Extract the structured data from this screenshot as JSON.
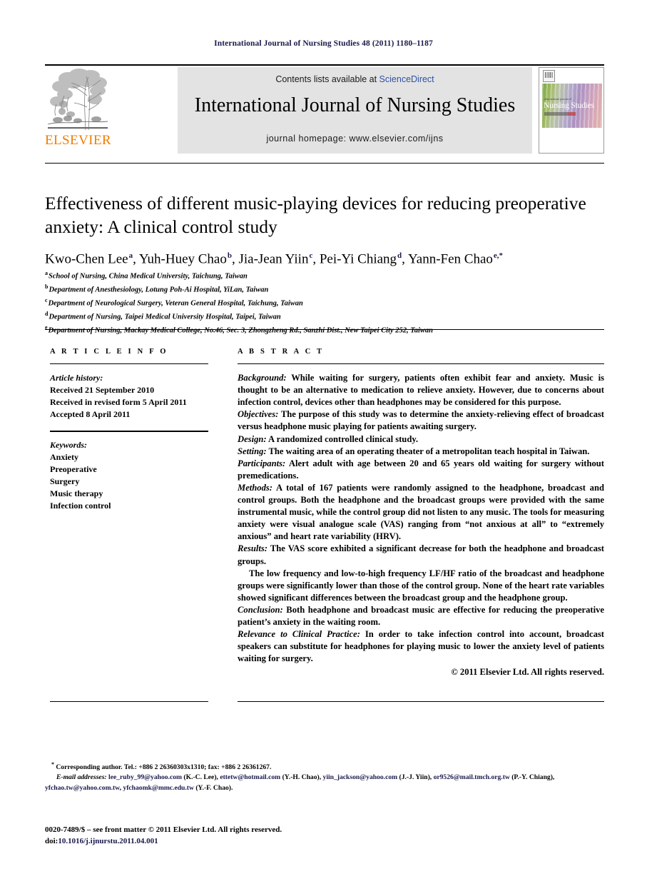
{
  "running_head": "International Journal of Nursing Studies 48 (2011) 1180–1187",
  "masthead": {
    "publisher_wordmark": "ELSEVIER",
    "contents_prefix": "Contents lists available at ",
    "contents_link": "ScienceDirect",
    "journal_title": "International Journal of Nursing Studies",
    "homepage": "journal homepage: www.elsevier.com/ijns",
    "cover": {
      "small_line": "international journal of",
      "title": "Nursing Studies",
      "editors_line": "Editor-in-Chief: Ian Norman"
    }
  },
  "article": {
    "title": "Effectiveness of different music-playing devices for reducing preoperative anxiety: A clinical control study",
    "authors": [
      {
        "name": "Kwo-Chen Lee",
        "sup": "a",
        "sep": ", "
      },
      {
        "name": "Yuh-Huey Chao",
        "sup": "b",
        "sep": ", "
      },
      {
        "name": "Jia-Jean Yiin",
        "sup": "c",
        "sep": ", "
      },
      {
        "name": "Pei-Yi Chiang",
        "sup": "d",
        "sep": ", "
      },
      {
        "name": "Yann-Fen Chao",
        "sup": "e,*",
        "sep": ""
      }
    ],
    "affiliations": [
      {
        "sup": "a",
        "text": "School of Nursing, China Medical University, Taichung, Taiwan"
      },
      {
        "sup": "b",
        "text": "Department of Anesthesiology, Lotung Poh-Ai Hospital, YiLan, Taiwan"
      },
      {
        "sup": "c",
        "text": "Department of Neurological Surgery, Veteran General Hospital, Taichung, Taiwan"
      },
      {
        "sup": "d",
        "text": "Department of Nursing, Taipei Medical University Hospital, Taipei, Taiwan"
      },
      {
        "sup": "e",
        "text": "Department of Nursing, Mackay Medical College, No.46, Sec. 3, Zhongzheng Rd., Sanzhi Dist., New Taipei City 252, Taiwan"
      }
    ]
  },
  "article_info": {
    "heading": "A R T I C L E  I N F O",
    "history_label": "Article history:",
    "history": [
      "Received 21 September 2010",
      "Received in revised form 5 April 2011",
      "Accepted 8 April 2011"
    ],
    "keywords_label": "Keywords:",
    "keywords": [
      "Anxiety",
      "Preoperative",
      "Surgery",
      "Music therapy",
      "Infection control"
    ]
  },
  "abstract": {
    "heading": "A B S T R A C T",
    "sections": [
      {
        "label": "Background:",
        "text": " While waiting for surgery, patients often exhibit fear and anxiety. Music is thought to be an alternative to medication to relieve anxiety. However, due to concerns about infection control, devices other than headphones may be considered for this purpose."
      },
      {
        "label": "Objectives:",
        "text": " The purpose of this study was to determine the anxiety-relieving effect of broadcast versus headphone music playing for patients awaiting surgery."
      },
      {
        "label": "Design:",
        "text": " A randomized controlled clinical study."
      },
      {
        "label": "Setting:",
        "text": " The waiting area of an operating theater of a metropolitan teach hospital in Taiwan."
      },
      {
        "label": "Participants:",
        "text": " Alert adult with age between 20 and 65 years old waiting for surgery without premedications."
      },
      {
        "label": "Methods:",
        "text": " A total of 167 patients were randomly assigned to the headphone, broadcast and control groups. Both the headphone and the broadcast groups were provided with the same instrumental music, while the control group did not listen to any music. The tools for measuring anxiety were visual analogue scale (VAS) ranging from “not anxious at all” to “extremely anxious” and heart rate variability (HRV)."
      },
      {
        "label": "Results:",
        "text": " The VAS score exhibited a significant decrease for both the headphone and broadcast groups."
      },
      {
        "label": "",
        "indent": true,
        "text": "The low frequency and low-to-high frequency LF/HF ratio of the broadcast and headphone groups were significantly lower than those of the control group. None of the heart rate variables showed significant differences between the broadcast group and the headphone group."
      },
      {
        "label": "Conclusion:",
        "text": " Both headphone and broadcast music are effective for reducing the preoperative patient’s anxiety in the waiting room."
      },
      {
        "label": "Relevance to Clinical Practice:",
        "text": " In order to take infection control into account, broadcast speakers can substitute for headphones for playing music to lower the anxiety level of patients waiting for surgery."
      }
    ],
    "copyright": "© 2011 Elsevier Ltd. All rights reserved."
  },
  "footnotes": {
    "corresponding": "Corresponding author. Tel.: +886 2 26360303x1310; fax: +886 2 26361267.",
    "corresponding_marker": "*",
    "email_label": "E-mail addresses:",
    "emails": [
      {
        "address": "lee_ruby_99@yahoo.com",
        "person": " (K.-C. Lee), "
      },
      {
        "address": "ettetw@hotmail.com",
        "person": " (Y.-H. Chao), "
      },
      {
        "address": "yiin_jackson@yahoo.com",
        "person": " (J.-J. Yiin), "
      },
      {
        "address": "or9526@mail.tmch.org.tw",
        "person": " (P.-Y. Chiang), "
      },
      {
        "address": "yfchao.tw@yahoo.com.tw",
        "person": ", "
      },
      {
        "address": "yfchaomk@mmc.edu.tw",
        "person": " (Y.-F. Chao)."
      }
    ]
  },
  "imprint": {
    "issn_line": "0020-7489/$ – see front matter © 2011 Elsevier Ltd. All rights reserved.",
    "doi_prefix": "doi:",
    "doi": "10.1016/j.ijnurstu.2011.04.001"
  },
  "colors": {
    "link_blue": "#2e52a3",
    "dark_navy": "#19194b",
    "elsevier_orange": "#f07d00",
    "masthead_gray": "#e3e3e3"
  }
}
